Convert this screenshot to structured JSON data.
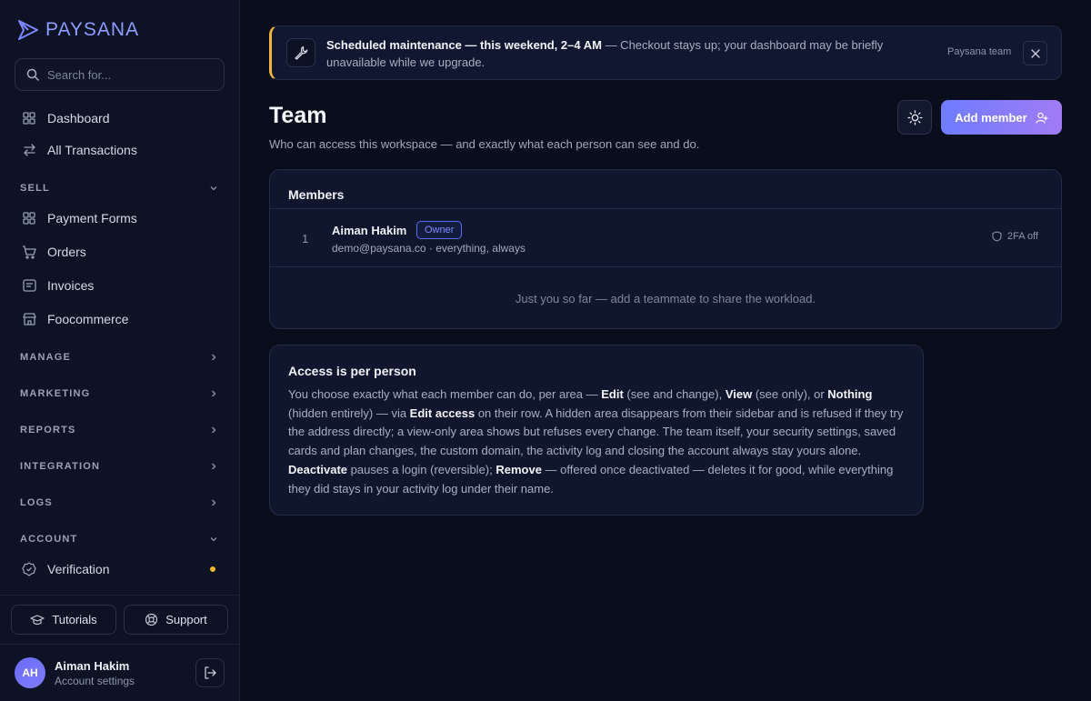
{
  "brand": {
    "name": "PAYSANA"
  },
  "search": {
    "placeholder": "Search for..."
  },
  "nav": {
    "dashboard": "Dashboard",
    "transactions": "All Transactions",
    "sell": {
      "label": "SELL",
      "items": [
        "Payment Forms",
        "Orders",
        "Invoices",
        "Foocommerce"
      ]
    },
    "manage": "MANAGE",
    "marketing": "MARKETING",
    "reports": "REPORTS",
    "integration": "INTEGRATION",
    "logs": "LOGS",
    "account": {
      "label": "ACCOUNT",
      "items": [
        "Verification"
      ]
    }
  },
  "footer": {
    "tutorials": "Tutorials",
    "support": "Support"
  },
  "user": {
    "initials": "AH",
    "name": "Aiman Hakim",
    "subtitle": "Account settings"
  },
  "banner": {
    "title": "Scheduled maintenance — this weekend, 2–4 AM",
    "message": " — Checkout stays up; your dashboard may be briefly unavailable while we upgrade.",
    "from": "Paysana team"
  },
  "page": {
    "title": "Team",
    "subtitle": "Who can access this workspace — and exactly what each person can see and do.",
    "add_button": "Add member"
  },
  "members": {
    "title": "Members",
    "rows": [
      {
        "number": "1",
        "name": "Aiman Hakim",
        "badge": "Owner",
        "detail": "demo@paysana.co · everything, always",
        "twofa": "2FA off"
      }
    ],
    "empty_text": "Just you so far — add a teammate to share the workload."
  },
  "access": {
    "title": "Access is per person",
    "t1": "You choose exactly what each member can do, per area — ",
    "edit": "Edit",
    "t2": " (see and change), ",
    "view": "View",
    "t3": " (see only), or ",
    "nothing": "Nothing",
    "t4": " (hidden entirely) — via ",
    "edit_access": "Edit access",
    "t5": " on their row. A hidden area disappears from their sidebar and is refused if they try the address directly; a view-only area shows but refuses every change. The team itself, your security settings, saved cards and plan changes, the custom domain, the activity log and closing the account always stay yours alone. ",
    "deactivate": "Deactivate",
    "t6": " pauses a login (reversible); ",
    "remove": "Remove",
    "t7": " — offered once deactivated — deletes it for good, while everything they did stays in your activity log under their name."
  },
  "colors": {
    "accent": "#6e7cff",
    "warning": "#f2b63a",
    "background": "#090d1c"
  }
}
